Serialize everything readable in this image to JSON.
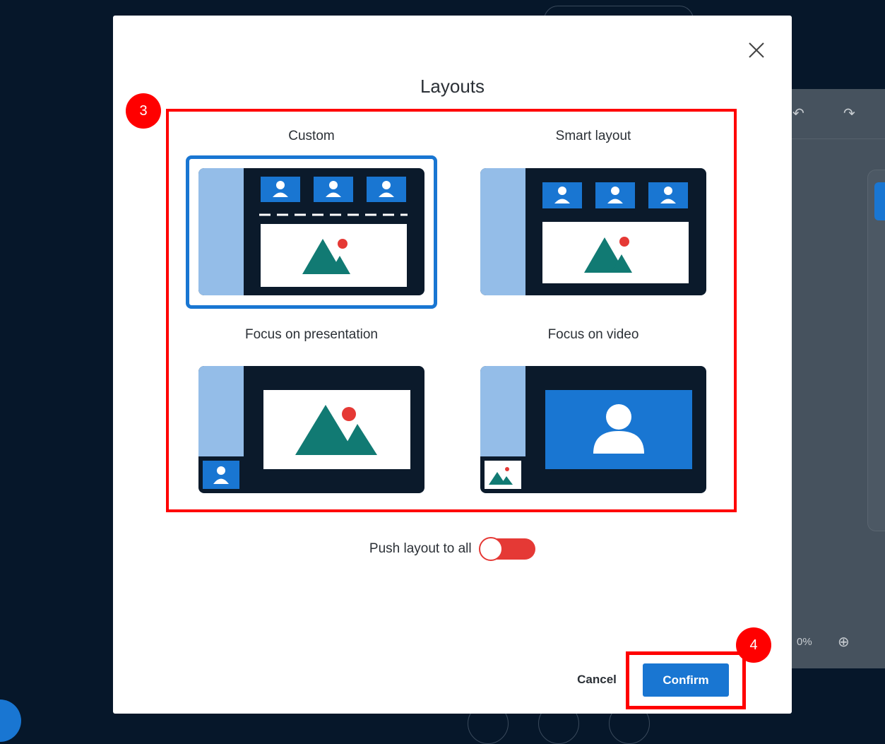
{
  "background": {
    "zoom_text": "0%",
    "plus_glyph": "⊕",
    "undo_glyph": "↶",
    "redo_glyph": "↷"
  },
  "dialog": {
    "title": "Layouts",
    "close_glyph": "✕",
    "annotation_badges": [
      "3",
      "4"
    ],
    "layouts": [
      {
        "label": "Custom",
        "selected": true
      },
      {
        "label": "Smart layout",
        "selected": false
      },
      {
        "label": "Focus on presentation",
        "selected": false
      },
      {
        "label": "Focus on video",
        "selected": false
      }
    ],
    "push_layout_label": "Push layout to all",
    "push_layout_on": false,
    "cancel_label": "Cancel",
    "confirm_label": "Confirm"
  },
  "colors": {
    "accent_blue": "#1976d2",
    "annotation_red": "#ff0000",
    "thumb_dark": "#0b1a2b",
    "thumb_sidebar": "#94bde8",
    "mountain_teal": "#117a73",
    "sun_red": "#e53935"
  },
  "icons": [
    "close-icon",
    "person-icon",
    "image-icon",
    "undo-icon",
    "redo-icon",
    "zoom-in-icon"
  ]
}
